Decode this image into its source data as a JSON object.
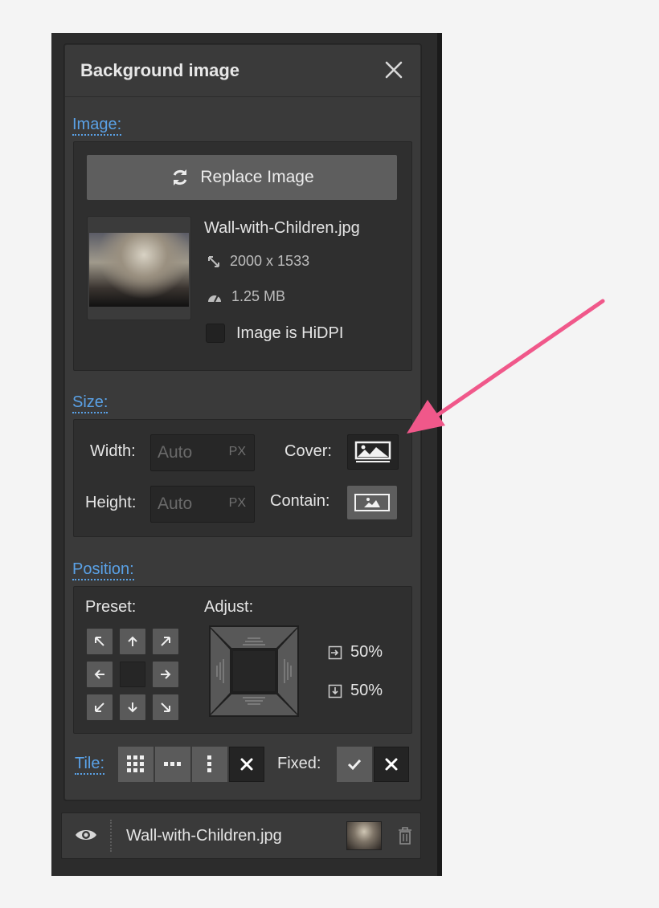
{
  "panel": {
    "title": "Background image"
  },
  "image_section": {
    "label": "Image:",
    "replace_button": "Replace Image",
    "file_name": "Wall-with-Children.jpg",
    "dimensions": "2000 x 1533",
    "file_size": "1.25 MB",
    "hidpi_label": "Image is HiDPI",
    "hidpi_checked": false
  },
  "size_section": {
    "label": "Size:",
    "width_label": "Width:",
    "height_label": "Height:",
    "width_placeholder": "Auto",
    "height_placeholder": "Auto",
    "unit": "PX",
    "cover_label": "Cover:",
    "contain_label": "Contain:"
  },
  "position_section": {
    "label": "Position:",
    "preset_label": "Preset:",
    "adjust_label": "Adjust:",
    "x_percent": "50%",
    "y_percent": "50%"
  },
  "tile": {
    "label": "Tile:",
    "fixed_label": "Fixed:"
  },
  "layer": {
    "name": "Wall-with-Children.jpg"
  },
  "colors": {
    "accent": "#5aa1e6",
    "annotation_arrow": "#f0588a"
  }
}
